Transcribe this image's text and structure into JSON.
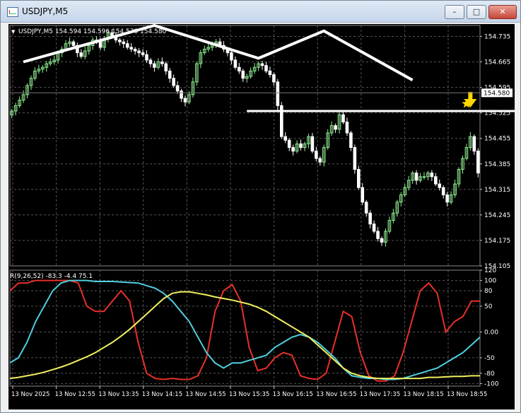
{
  "window": {
    "title": "USDJPY,M5",
    "minimize_label": "–",
    "maximize_label": "□",
    "close_label": "✕"
  },
  "colors": {
    "background": "#000000",
    "grid": "#555555",
    "bull": "#90ee90",
    "bear": "#ffffff",
    "annotation": "#ffffff",
    "arrow": "#ffd700",
    "red_line": "#e8302a",
    "cyan_line": "#4fd0e0",
    "yellow_line": "#f0f060",
    "price_label_bg": "#ffffff"
  },
  "chart_data": [
    {
      "type": "candlestick",
      "header": "USDJPY,M5  154.594 154.596 154.578 154.580",
      "y_ticks": [
        "154.735",
        "154.665",
        "154.595",
        "154.525",
        "154.455",
        "154.385",
        "154.315",
        "154.245",
        "154.175",
        "154.105"
      ],
      "ylim": [
        154.105,
        154.765
      ],
      "current_price": 154.58,
      "current_price_label": "154.580",
      "closes": [
        154.53,
        154.545,
        154.56,
        154.575,
        154.6,
        154.62,
        154.64,
        154.645,
        154.65,
        154.66,
        154.665,
        154.67,
        154.69,
        154.7,
        154.715,
        154.72,
        154.71,
        154.69,
        154.68,
        154.695,
        154.71,
        154.725,
        154.72,
        154.705,
        154.73,
        154.745,
        154.735,
        154.725,
        154.72,
        154.715,
        154.705,
        154.7,
        154.695,
        154.69,
        154.685,
        154.67,
        154.66,
        154.65,
        154.665,
        154.66,
        154.64,
        154.62,
        154.6,
        154.585,
        154.565,
        154.555,
        154.575,
        154.61,
        154.66,
        154.69,
        154.7,
        154.705,
        154.715,
        154.72,
        154.71,
        154.7,
        154.69,
        154.67,
        154.65,
        154.64,
        154.62,
        154.625,
        154.64,
        154.65,
        154.66,
        154.655,
        154.64,
        154.63,
        154.61,
        154.545,
        154.46,
        154.45,
        154.43,
        154.42,
        154.44,
        154.43,
        154.44,
        154.46,
        154.42,
        154.4,
        154.39,
        154.43,
        154.47,
        154.49,
        154.48,
        154.52,
        154.5,
        154.47,
        154.43,
        154.37,
        154.32,
        154.28,
        154.25,
        154.22,
        154.2,
        154.18,
        154.17,
        154.2,
        154.23,
        154.25,
        154.28,
        154.3,
        154.32,
        154.34,
        154.36,
        154.34,
        154.35,
        154.35,
        154.36,
        154.35,
        154.33,
        154.32,
        154.3,
        154.28,
        154.3,
        154.33,
        154.37,
        154.4,
        154.43,
        154.46,
        154.42,
        154.36
      ],
      "x_ticks": [
        "13 Nov 2025",
        "13 Nov 12:55",
        "13 Nov 13:35",
        "13 Nov 14:15",
        "13 Nov 14:55",
        "13 Nov 15:35",
        "13 Nov 16:15",
        "13 Nov 16:55",
        "13 Nov 17:35",
        "13 Nov 18:15",
        "13 Nov 18:55"
      ],
      "annotations": {
        "double_top": [
          [
            3,
            154.665
          ],
          [
            37,
            154.765
          ],
          [
            64,
            154.675
          ],
          [
            81,
            154.75
          ],
          [
            104,
            154.615
          ]
        ],
        "neckline": [
          [
            61,
            154.53
          ],
          [
            133,
            154.53
          ]
        ],
        "arrow_bar": 119,
        "star_bar": 118,
        "star_price": 154.55
      }
    },
    {
      "type": "line",
      "header": "R(9,26,52) -83.3 -4.4 75.1",
      "ylim": [
        -105,
        120
      ],
      "y_ticks": [
        "120",
        "100",
        "80",
        "50",
        "0.00",
        "-50",
        "-80",
        "-100"
      ],
      "y_tick_values": [
        120,
        100,
        80,
        50,
        0,
        -50,
        -80,
        -100
      ],
      "hlines": [
        100,
        80,
        50,
        0,
        -50,
        -80,
        -100
      ],
      "series": [
        {
          "color_key": "red_line",
          "values": [
            80,
            95,
            95,
            100,
            100,
            100,
            100,
            100,
            95,
            50,
            40,
            40,
            60,
            80,
            60,
            -20,
            -80,
            -90,
            -92,
            -90,
            -92,
            -92,
            -85,
            -50,
            40,
            80,
            92,
            60,
            -30,
            -75,
            -70,
            -50,
            -40,
            -45,
            -85,
            -90,
            -92,
            -80,
            -20,
            40,
            30,
            -40,
            -85,
            -95,
            -95,
            -85,
            -40,
            20,
            80,
            95,
            75,
            0,
            20,
            30,
            60,
            60
          ]
        },
        {
          "color_key": "cyan_line",
          "values": [
            -60,
            -50,
            -20,
            20,
            50,
            80,
            95,
            100,
            100,
            100,
            98,
            98,
            98,
            97,
            96,
            95,
            90,
            85,
            75,
            60,
            40,
            20,
            -10,
            -40,
            -60,
            -70,
            -60,
            -60,
            -55,
            -50,
            -45,
            -30,
            -20,
            -10,
            -5,
            -10,
            -20,
            -35,
            -50,
            -70,
            -85,
            -88,
            -90,
            -90,
            -92,
            -92,
            -90,
            -85,
            -80,
            -75,
            -70,
            -60,
            -50,
            -40,
            -25,
            -10
          ]
        },
        {
          "color_key": "yellow_line",
          "values": [
            -90,
            -88,
            -85,
            -82,
            -78,
            -73,
            -68,
            -62,
            -55,
            -48,
            -40,
            -30,
            -20,
            -8,
            5,
            20,
            35,
            50,
            65,
            75,
            78,
            78,
            75,
            72,
            68,
            65,
            62,
            58,
            54,
            48,
            40,
            30,
            20,
            10,
            0,
            -10,
            -25,
            -40,
            -55,
            -70,
            -80,
            -85,
            -88,
            -90,
            -90,
            -90,
            -90,
            -90,
            -90,
            -88,
            -88,
            -87,
            -86,
            -86,
            -85,
            -85
          ]
        }
      ]
    }
  ]
}
